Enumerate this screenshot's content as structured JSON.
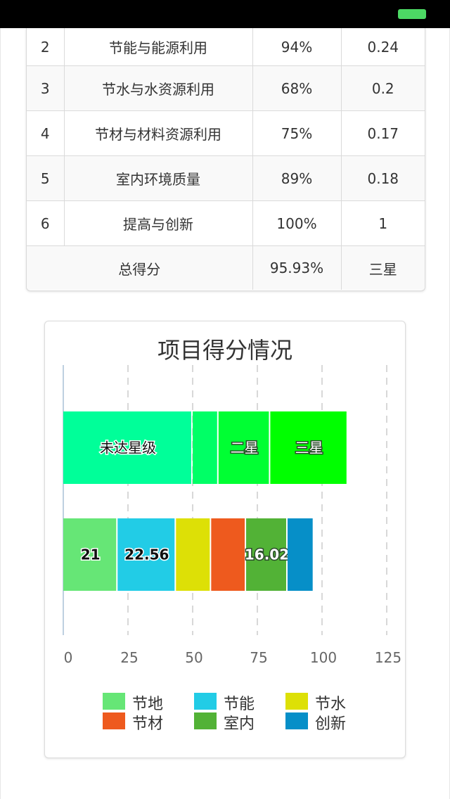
{
  "table": {
    "rows": [
      {
        "no": "2",
        "name": "节能与能源利用",
        "rate": "94%",
        "weight": "0.24"
      },
      {
        "no": "3",
        "name": "节水与水资源利用",
        "rate": "68%",
        "weight": "0.2"
      },
      {
        "no": "4",
        "name": "节材与材料资源利用",
        "rate": "75%",
        "weight": "0.17"
      },
      {
        "no": "5",
        "name": "室内环境质量",
        "rate": "89%",
        "weight": "0.18"
      },
      {
        "no": "6",
        "name": "提高与创新",
        "rate": "100%",
        "weight": "1"
      }
    ],
    "total": {
      "label": "总得分",
      "rate": "95.93%",
      "grade": "三星"
    }
  },
  "chart_data": {
    "type": "bar",
    "orientation": "horizontal",
    "stacked": true,
    "title": "项目得分情况",
    "xlim": [
      0,
      125
    ],
    "xticks": [
      "0",
      "25",
      "50",
      "75",
      "100",
      "125"
    ],
    "grid": true,
    "legend_placement": "bottom",
    "rows": [
      {
        "segments": [
          {
            "value": 50,
            "label": "未达星级",
            "color": "#00ff99"
          },
          {
            "value": 10,
            "label": "",
            "color": "#00ff66"
          },
          {
            "value": 20,
            "label": "二星",
            "color": "#00ff33"
          },
          {
            "value": 30,
            "label": "三星",
            "color": "#00ff00"
          }
        ]
      },
      {
        "segments": [
          {
            "value": 21,
            "label": "21",
            "color": "#66e676"
          },
          {
            "value": 22.56,
            "label": "22.56",
            "color": "#22cce6"
          },
          {
            "value": 13.6,
            "label": "",
            "color": "#dde006"
          },
          {
            "value": 13.5,
            "label": "",
            "color": "#ee5a1e"
          },
          {
            "value": 16.02,
            "label": "16.02",
            "color": "#52b236"
          },
          {
            "value": 10.25,
            "label": "",
            "color": "#068fc8"
          }
        ]
      }
    ],
    "legend": [
      {
        "name": "节地",
        "color": "#66e676"
      },
      {
        "name": "节能",
        "color": "#22cce6"
      },
      {
        "name": "节水",
        "color": "#dde006"
      },
      {
        "name": "节材",
        "color": "#ee5a1e"
      },
      {
        "name": "室内",
        "color": "#52b236"
      },
      {
        "name": "创新",
        "color": "#068fc8"
      }
    ]
  }
}
